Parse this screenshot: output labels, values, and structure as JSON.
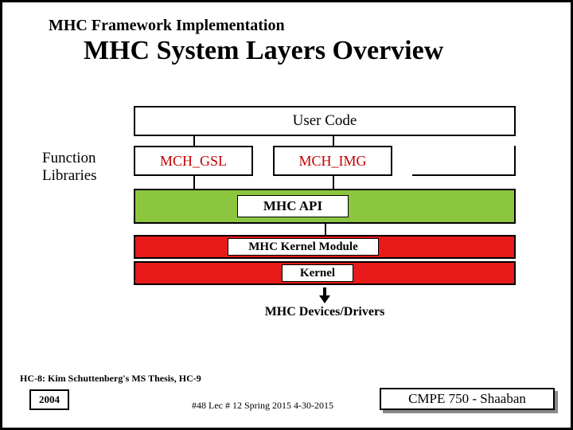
{
  "header": {
    "subtitle": "MHC Framework Implementation",
    "title": "MHC System Layers Overview"
  },
  "diagram": {
    "func_libraries_label": "Function\nLibraries",
    "user_code": "User Code",
    "lib1": "MCH_GSL",
    "lib2": "MCH_IMG",
    "api": "MHC API",
    "kernel_module": "MHC Kernel Module",
    "kernel": "Kernel",
    "devices": "MHC Devices/Drivers"
  },
  "footer": {
    "hc_ref": "HC-8: Kim Schuttenberg's MS Thesis, HC-9",
    "year": "2004",
    "mid": "#48  Lec # 12   Spring 2015  4-30-2015",
    "course": "CMPE 750 - Shaaban"
  }
}
